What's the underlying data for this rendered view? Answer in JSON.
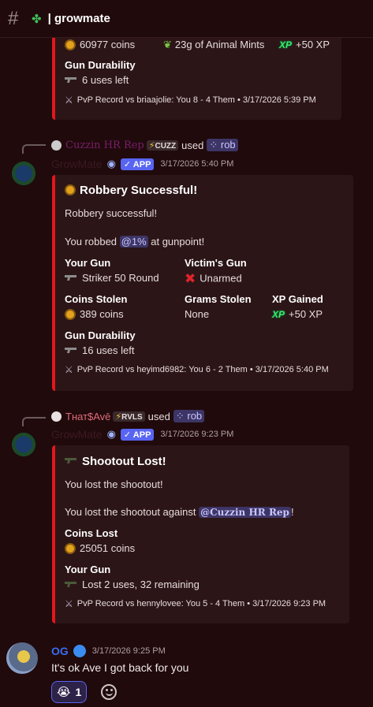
{
  "channel": {
    "title": "growmate",
    "icon": "clover-icon"
  },
  "embed0": {
    "coins": "60977 coins",
    "mints": "23g of Animal Mints",
    "xp": "+50 XP",
    "xp_icon": "XP",
    "durability_label": "Gun Durability",
    "durability_value": "6 uses left",
    "footer": "PvP Record vs briaajolie: You 8 - 4 Them • 3/17/2026 5:39 PM"
  },
  "msg1": {
    "reply_user": "Cuzzin HR Rep",
    "reply_tag": "CUZZ",
    "reply_used": "used",
    "reply_cmd": "rob",
    "bot_name": "GrowMate",
    "app_badge": "✓ APP",
    "timestamp": "3/17/2026 5:40 PM",
    "embed": {
      "title": "Robbery Successful!",
      "line1": "Robbery successful!",
      "line2_pre": "You robbed ",
      "line2_mention": "@1%",
      "line2_post": " at gunpoint!",
      "your_gun_label": "Your Gun",
      "your_gun_value": "Striker 50 Round",
      "victim_gun_label": "Victim's Gun",
      "victim_gun_value": "Unarmed",
      "coins_label": "Coins Stolen",
      "coins_value": "389 coins",
      "grams_label": "Grams Stolen",
      "grams_value": "None",
      "xp_label": "XP Gained",
      "xp_value": "+50 XP",
      "durability_label": "Gun Durability",
      "durability_value": "16 uses left",
      "footer": "PvP Record vs heyimd6982: You 6 - 2 Them • 3/17/2026 5:40 PM"
    }
  },
  "msg2": {
    "reply_user": "Тнат$Avē",
    "reply_tag": "RVLS",
    "reply_used": "used",
    "reply_cmd": "rob",
    "bot_name": "GrowMate",
    "app_badge": "✓ APP",
    "timestamp": "3/17/2026 9:23 PM",
    "embed": {
      "title": "Shootout Lost!",
      "line1": "You lost the shootout!",
      "line2_pre": "You lost the shootout against ",
      "line2_mention": "@Cuzzin HR Rep",
      "line2_post": "!",
      "coins_label": "Coins Lost",
      "coins_value": "25051 coins",
      "gun_label": "Your Gun",
      "gun_value": "Lost 2 uses, 32 remaining",
      "footer": "PvP Record vs hennylovee: You 5 - 4 Them • 3/17/2026 9:23 PM"
    }
  },
  "msg3": {
    "user": "OG",
    "timestamp": "3/17/2026 9:25 PM",
    "text": "It's ok Ave I got back for you",
    "reaction_emoji": "😭",
    "reaction_count": "1"
  },
  "colors": {
    "embed_border": "#e5161d",
    "mention": "#c9c6ff",
    "app_badge": "#5865f2"
  }
}
